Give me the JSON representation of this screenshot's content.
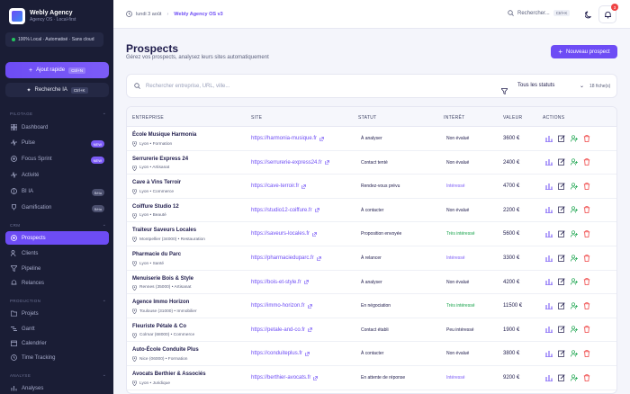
{
  "brand": {
    "name": "Webly Agency",
    "subtitle": "Agency OS · Local-first"
  },
  "local_badge": "100% Local · Automatisé · Sans cloud",
  "quick_add": {
    "label": "Ajout rapide",
    "shortcut": "Ctrl+N"
  },
  "ai_search": {
    "label": "Recherche IA",
    "shortcut": "Ctrl+K"
  },
  "sections": {
    "pilotage": "PILOTAGE",
    "crm": "CRM",
    "production": "PRODUCTION",
    "analyse": "ANALYSE"
  },
  "nav": {
    "dashboard": "Dashboard",
    "pulse": "Pulse",
    "focus": "Focus Sprint",
    "activite": "Activité",
    "bi": "BI IA",
    "gamification": "Gamification",
    "prospects": "Prospects",
    "clients": "Clients",
    "pipeline": "Pipeline",
    "relances": "Relances",
    "projets": "Projets",
    "gantt": "Gantt",
    "calendrier": "Calendrier",
    "time": "Time Tracking",
    "analyses": "Analyses"
  },
  "badges": {
    "new": "NEW",
    "beta": "Bêta"
  },
  "topbar": {
    "date": "lundi 3 août",
    "breadcrumb": "Webly Agency OS v3",
    "search": "Rechercher...",
    "search_kbd": "Ctrl+K",
    "notif_count": "3"
  },
  "page": {
    "title": "Prospects",
    "subtitle": "Gérez vos prospects, analysez leurs sites automatiquement",
    "new_button": "Nouveau prospect"
  },
  "filter": {
    "placeholder": "Rechercher entreprise, URL, ville...",
    "status": "Tous les statuts",
    "count": "18 fiche(s)"
  },
  "columns": {
    "entreprise": "ENTREPRISE",
    "site": "SITE",
    "statut": "STATUT",
    "interet": "INTÉRÊT",
    "valeur": "VALEUR",
    "actions": "ACTIONS"
  },
  "colors": {
    "accent": "#6d4cf5",
    "interesse": "#7c5cf7",
    "tres_interesse": "#16a34a",
    "neutral": "#1e1b4b"
  },
  "rows": [
    {
      "name": "École Musique Harmonia",
      "loc": "Lyon • Formation",
      "site": "https://harmonia-musique.fr",
      "status": "À analyser",
      "interest": "Non évalué",
      "interest_color": "#1e1b4b",
      "value": "3600 €"
    },
    {
      "name": "Serrurerie Express 24",
      "loc": "Lyon • Artisanat",
      "site": "https://serrurerie-express24.fr",
      "status": "Contact tenté",
      "interest": "Non évalué",
      "interest_color": "#1e1b4b",
      "value": "2400 €"
    },
    {
      "name": "Cave à Vins Terroir",
      "loc": "Lyon • Commerce",
      "site": "https://cave-terroir.fr",
      "status": "Rendez-vous prévu",
      "interest": "Intéressé",
      "interest_color": "#7c5cf7",
      "value": "4700 €"
    },
    {
      "name": "Coiffure Studio 12",
      "loc": "Lyon • Beauté",
      "site": "https://studio12-coiffure.fr",
      "status": "À contacter",
      "interest": "Non évalué",
      "interest_color": "#1e1b4b",
      "value": "2200 €"
    },
    {
      "name": "Traiteur Saveurs Locales",
      "loc": "Montpellier (34000) • Restauration",
      "site": "https://saveurs-locales.fr",
      "status": "Proposition envoyée",
      "interest": "Très intéressé",
      "interest_color": "#16a34a",
      "value": "5600 €"
    },
    {
      "name": "Pharmacie du Parc",
      "loc": "Lyon • Santé",
      "site": "https://pharmacieduparc.fr",
      "status": "À relancer",
      "interest": "Intéressé",
      "interest_color": "#7c5cf7",
      "value": "3300 €"
    },
    {
      "name": "Menuiserie Bois & Style",
      "loc": "Rennes (35000) • Artisanat",
      "site": "https://bois-et-style.fr",
      "status": "À analyser",
      "interest": "Non évalué",
      "interest_color": "#1e1b4b",
      "value": "4200 €"
    },
    {
      "name": "Agence Immo Horizon",
      "loc": "Toulouse (31000) • Immobilier",
      "site": "https://immo-horizon.fr",
      "status": "En négociation",
      "interest": "Très intéressé",
      "interest_color": "#16a34a",
      "value": "11500 €"
    },
    {
      "name": "Fleuriste Pétale & Co",
      "loc": "Colmar (68000) • Commerce",
      "site": "https://petale-and-co.fr",
      "status": "Contact établi",
      "interest": "Peu intéressé",
      "interest_color": "#1e1b4b",
      "value": "1900 €"
    },
    {
      "name": "Auto-École Conduite Plus",
      "loc": "Nice (06000) • Formation",
      "site": "https://conduiteplus.fr",
      "status": "À contacter",
      "interest": "Non évalué",
      "interest_color": "#1e1b4b",
      "value": "3800 €"
    },
    {
      "name": "Avocats Berthier & Associés",
      "loc": "Lyon • Juridique",
      "site": "https://berthier-avocats.fr",
      "status": "En attente de réponse",
      "interest": "Intéressé",
      "interest_color": "#7c5cf7",
      "value": "9200 €"
    }
  ]
}
